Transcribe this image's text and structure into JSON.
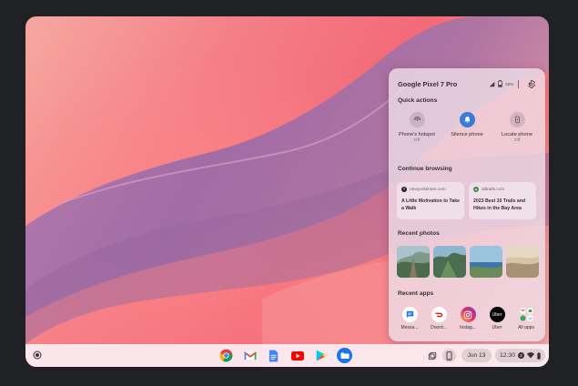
{
  "phone_hub": {
    "device_name": "Google Pixel 7 Pro",
    "battery": "26%",
    "quick_actions_title": "Quick actions",
    "quick_actions": [
      {
        "label": "Phone's hotspot",
        "state": "Off"
      },
      {
        "label": "Silence phone",
        "state": ""
      },
      {
        "label": "Locate phone",
        "state": "Off"
      }
    ],
    "continue_browsing_title": "Continue browsing",
    "browsing": [
      {
        "site": "newyorktimes.com",
        "title": "A Little Motivation to Take a Walk"
      },
      {
        "site": "alltrails.com",
        "title": "2023 Best 10 Trails and Hikes in the Bay Area"
      }
    ],
    "recent_photos_title": "Recent photos",
    "recent_apps_title": "Recent apps",
    "recent_apps": [
      {
        "label": "Messa...",
        "icon": "messages-icon"
      },
      {
        "label": "Doord...",
        "icon": "doordash-icon"
      },
      {
        "label": "Instag...",
        "icon": "instagram-icon"
      },
      {
        "label": "Uber",
        "icon": "uber-icon",
        "text": "Uber"
      },
      {
        "label": "All apps",
        "icon": "all-apps-icon"
      }
    ]
  },
  "shelf": {
    "apps": [
      "chrome-icon",
      "gmail-icon",
      "docs-icon",
      "youtube-icon",
      "play-store-icon",
      "files-icon"
    ],
    "date": "Jun 13",
    "time": "12:30",
    "notification_count": "2"
  },
  "colors": {
    "accent_blue": "#3a7bd5",
    "panel_bg": "#eedee8",
    "wallpaper_pink": "#f36a78",
    "wallpaper_purple": "#9a6aa8"
  }
}
